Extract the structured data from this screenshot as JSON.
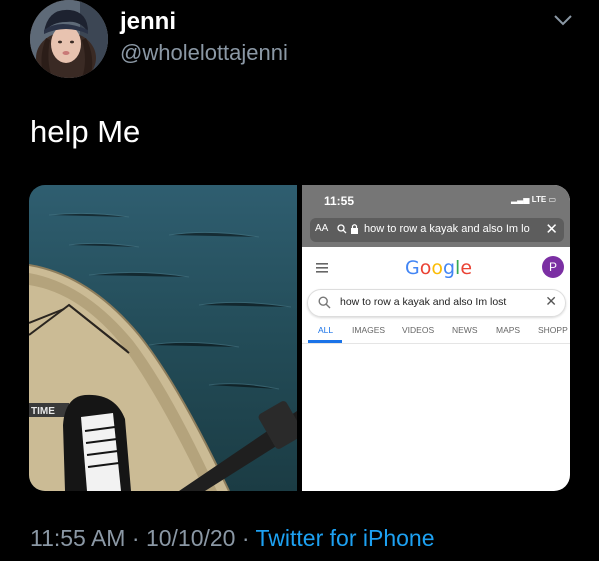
{
  "author": {
    "display_name": "jenni",
    "handle": "@wholelottajenni"
  },
  "tweet": {
    "text": "help Me"
  },
  "kayak_photo": {
    "brand_text": "TIME"
  },
  "phone_screenshot": {
    "status_time": "11:55",
    "network": "LTE",
    "url_bar": {
      "aa_label": "AA",
      "text": "how to row a kayak and also Im lo"
    },
    "google_logo": "Google",
    "profile_initial": "P",
    "search_query": "how to row a kayak and also Im lost",
    "tabs": [
      "ALL",
      "IMAGES",
      "VIDEOS",
      "NEWS",
      "MAPS",
      "SHOPP"
    ]
  },
  "meta": {
    "time": "11:55 AM",
    "date": "10/10/20",
    "separator": "·",
    "source": "Twitter for iPhone"
  },
  "colors": {
    "background": "#000000",
    "secondary_text": "#8b98a5",
    "link": "#1da1f2",
    "google_blue": "#1a73e8"
  }
}
